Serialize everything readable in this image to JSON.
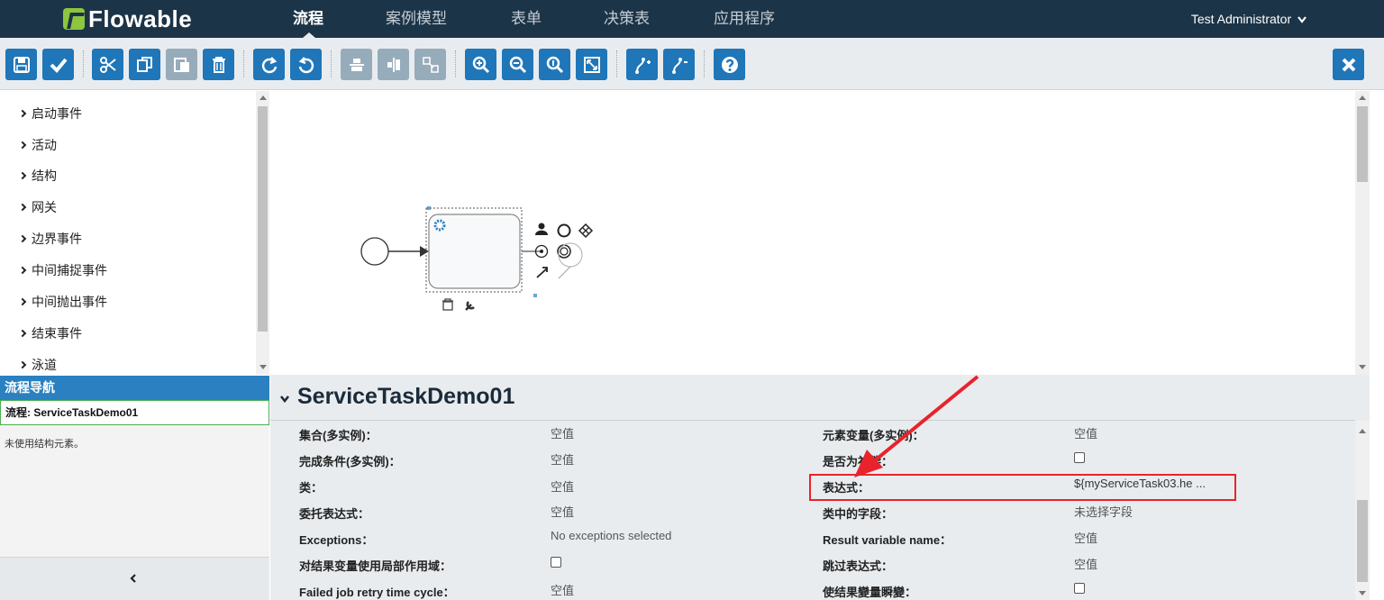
{
  "app": {
    "brand": "Flowable",
    "user": "Test Administrator"
  },
  "nav": {
    "tabs": [
      "流程",
      "案例模型",
      "表单",
      "决策表",
      "应用程序"
    ],
    "active": 0
  },
  "toolbar": {
    "buttons": [
      {
        "name": "save",
        "icon": "save-icon"
      },
      {
        "name": "validate",
        "icon": "check-icon"
      },
      {
        "name": "cut",
        "icon": "scissors-icon"
      },
      {
        "name": "copy",
        "icon": "copy-icon"
      },
      {
        "name": "paste",
        "icon": "paste-icon"
      },
      {
        "name": "delete",
        "icon": "trash-icon"
      },
      {
        "name": "redo",
        "icon": "redo-icon"
      },
      {
        "name": "undo",
        "icon": "undo-icon"
      },
      {
        "name": "align-horizontal",
        "icon": "align-horizontal-icon"
      },
      {
        "name": "align-vertical",
        "icon": "align-vertical-icon"
      },
      {
        "name": "same-size",
        "icon": "same-size-icon"
      },
      {
        "name": "zoom-in",
        "icon": "zoom-in-icon"
      },
      {
        "name": "zoom-out",
        "icon": "zoom-out-icon"
      },
      {
        "name": "zoom-actual",
        "icon": "zoom-actual-icon"
      },
      {
        "name": "zoom-fit",
        "icon": "zoom-fit-icon"
      },
      {
        "name": "add-bendpoint",
        "icon": "add-bendpoint-icon"
      },
      {
        "name": "remove-bendpoint",
        "icon": "remove-bendpoint-icon"
      },
      {
        "name": "help",
        "icon": "help-icon"
      },
      {
        "name": "close",
        "icon": "close-icon"
      }
    ]
  },
  "palette": {
    "items": [
      "启动事件",
      "活动",
      "结构",
      "网关",
      "边界事件",
      "中间捕捉事件",
      "中间抛出事件",
      "结束事件",
      "泳道"
    ]
  },
  "navigator": {
    "header": "流程导航",
    "process": "流程: ServiceTaskDemo01",
    "note": "未使用结构元素。"
  },
  "properties": {
    "title": "ServiceTaskDemo01",
    "left": [
      {
        "label": "集合(多实例)：",
        "value": "空值"
      },
      {
        "label": "完成条件(多实例)：",
        "value": "空值"
      },
      {
        "label": "类：",
        "value": "空值"
      },
      {
        "label": "委托表达式：",
        "value": "空值"
      },
      {
        "label": "Exceptions：",
        "value": "No exceptions selected"
      },
      {
        "label": "对结果变量使用局部作用域：",
        "value": "checkbox"
      },
      {
        "label": "Failed job retry time cycle：",
        "value": "空值"
      }
    ],
    "right": [
      {
        "label": "元素变量(多实例)：",
        "value": "空值"
      },
      {
        "label": "是否为补偿：",
        "value": "checkbox"
      },
      {
        "label": "表达式：",
        "value": "${myServiceTask03.he ..."
      },
      {
        "label": "类中的字段：",
        "value": "未选择字段"
      },
      {
        "label": "Result variable name：",
        "value": "空值"
      },
      {
        "label": "跳过表达式：",
        "value": "空值"
      },
      {
        "label": "使结果變量瞬變：",
        "value": "checkbox"
      }
    ]
  },
  "colors": {
    "nav_bg": "#1c3447",
    "button_blue": "#1f76b9",
    "highlight_red": "#e8232b",
    "nav_header_blue": "#2a80c0"
  }
}
